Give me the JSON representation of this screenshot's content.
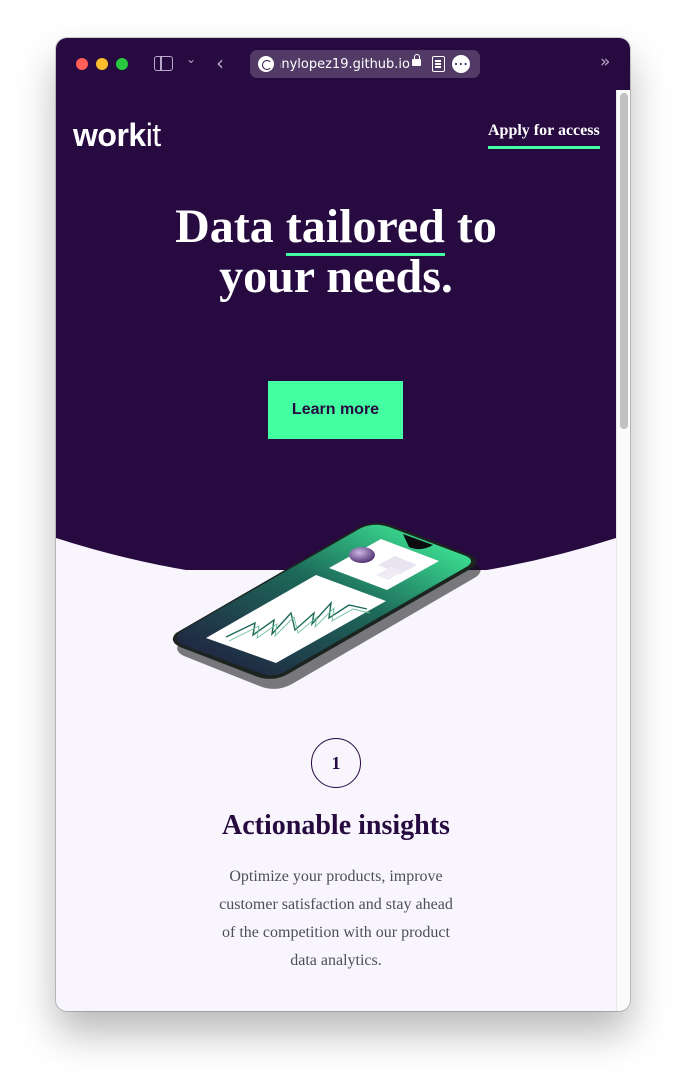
{
  "browser": {
    "url": "anylopez19.github.io",
    "icons": [
      "sidebar-icon",
      "chevron-down-icon",
      "back-icon",
      "favicon",
      "lock-icon",
      "reader-icon",
      "more-icon",
      "chevron-right-double-icon"
    ]
  },
  "site": {
    "logo_bold": "work",
    "logo_light": "it",
    "apply_link": "Apply for access",
    "headline_1": "Data ",
    "headline_highlight": "tailored",
    "headline_2": " to",
    "headline_3": "your needs.",
    "cta": "Learn more"
  },
  "feature": {
    "number": "1",
    "title": "Actionable insights",
    "text": "Optimize your products, improve customer satisfaction and stay ahead of the competition with our product data analytics."
  },
  "colors": {
    "brand_dark": "#260a40",
    "accent": "#44ffa1",
    "background": "#f8f5fd"
  }
}
